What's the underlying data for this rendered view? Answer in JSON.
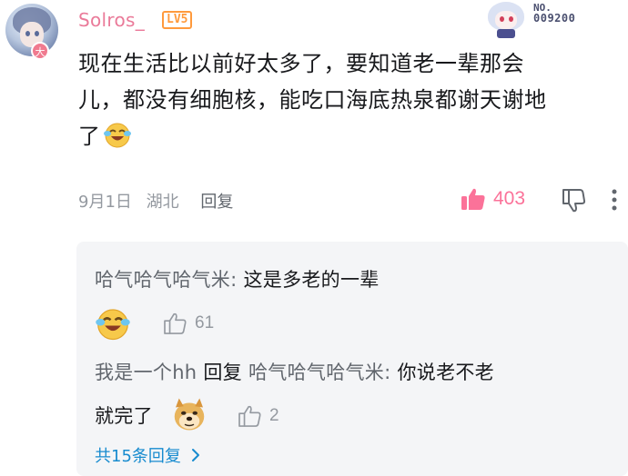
{
  "comment": {
    "username": "Solros_",
    "level": "LV5",
    "avatar_badge": "大",
    "fan_badge": {
      "label": "NO.",
      "number": "009200"
    },
    "content_lines": [
      "现在生活比以前好太多了，要知道老一辈那会",
      "儿，都没有细胞核，能吃口海底热泉都谢天谢地",
      "了"
    ],
    "date": "9月1日",
    "location": "湖北",
    "reply_label": "回复",
    "like_count": "403"
  },
  "replies": [
    {
      "author": "哈气哈气哈气米",
      "separator": ":",
      "text": "这是多老的一辈",
      "emoji": "laughing-crying-emoji",
      "like_count": "61"
    },
    {
      "author": "我是一个hh",
      "reply_word": "回复",
      "target": "哈气哈气哈气米",
      "separator": ":",
      "text_line1": "你说老不老",
      "text_line2": "就完了",
      "emoji": "doge-emoji",
      "like_count": "2"
    }
  ],
  "total_replies_label": "共15条回复",
  "colors": {
    "username": "#ea7a99",
    "level": "#ff9a3c",
    "like_active": "#fb7299",
    "link": "#178bcf",
    "meta": "#9499a0",
    "sub_bg": "#f4f5f7"
  }
}
